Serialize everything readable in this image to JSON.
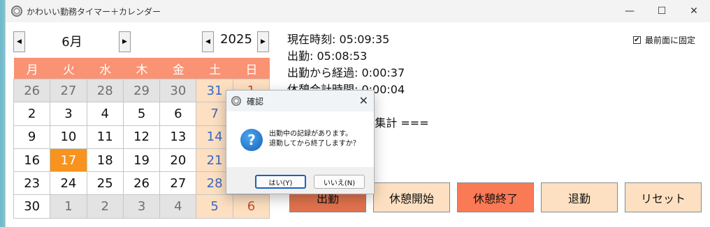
{
  "window": {
    "title": "かわいい勤務タイマー＋カレンダー"
  },
  "titlebar_controls": {
    "minimize": "—",
    "maximize": "☐",
    "close": "✕"
  },
  "calendar": {
    "month_prev": "◀",
    "month_label": "6月",
    "month_next": "▶",
    "year_prev": "◀",
    "year_label": "2025",
    "year_next": "▶",
    "weekdays": [
      "月",
      "火",
      "水",
      "木",
      "金",
      "土",
      "日"
    ],
    "weeks": [
      [
        "26",
        "27",
        "28",
        "29",
        "30",
        "31",
        "1"
      ],
      [
        "2",
        "3",
        "4",
        "5",
        "6",
        "7",
        "8"
      ],
      [
        "9",
        "10",
        "11",
        "12",
        "13",
        "14",
        "15"
      ],
      [
        "16",
        "17",
        "18",
        "19",
        "20",
        "21",
        "22"
      ],
      [
        "23",
        "24",
        "25",
        "26",
        "27",
        "28",
        "29"
      ],
      [
        "30",
        "1",
        "2",
        "3",
        "4",
        "5",
        "6"
      ]
    ],
    "today": "17"
  },
  "status": {
    "current_time": "現在時刻: 05:09:35",
    "clock_in": "出勤: 05:08:53",
    "elapsed": "出勤から経過: 0:00:37",
    "break_total": "休憩合計時間: 0:00:04",
    "summary": "=== 今日の勤務集計 ==="
  },
  "topmost": {
    "label": "最前面に固定",
    "checked": "✔"
  },
  "actions": {
    "clock_in": "出勤",
    "break_start": "休憩開始",
    "break_end": "休憩終了",
    "clock_out": "退勤",
    "reset": "リセット"
  },
  "dialog": {
    "title": "確認",
    "close": "✕",
    "icon": "?",
    "message_line1": "出勤中の記録があります。",
    "message_line2": "退勤してから終了しますか？",
    "yes": "はい(Y)",
    "no": "いいえ(N)"
  },
  "colors": {
    "header_bg": "#fa9274",
    "today_bg": "#f7931e",
    "weekend_bg": "#fde0c1",
    "clock_in_btn": "#e2734e",
    "break_end_btn": "#fa7a55",
    "light_btn": "#fde0c1"
  }
}
